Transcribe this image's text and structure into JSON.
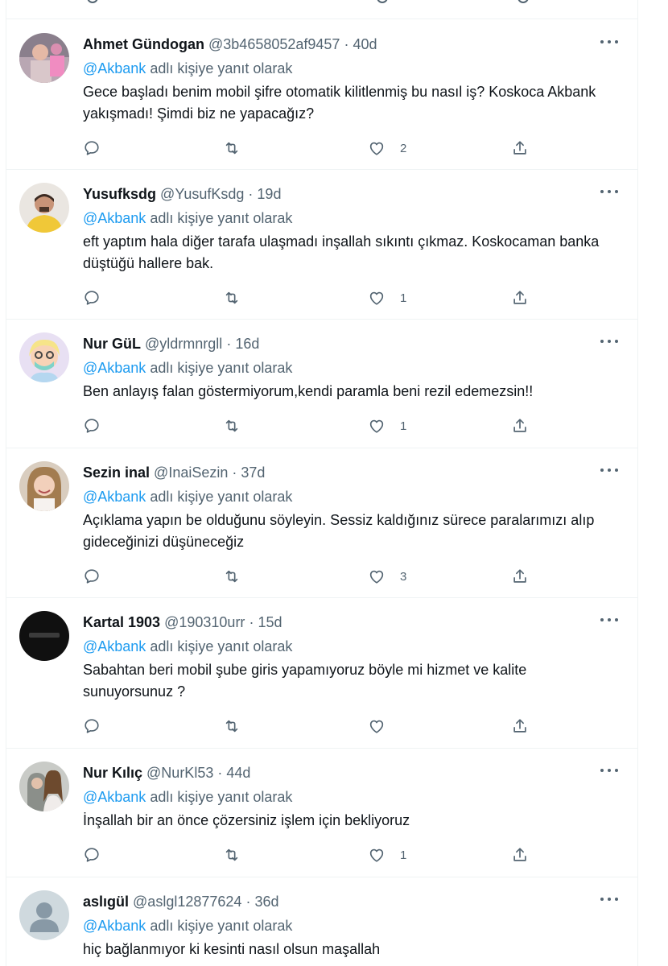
{
  "colors": {
    "accent": "#1d9bf0",
    "muted": "#536471",
    "text": "#0f1419",
    "divider": "#eff3f4"
  },
  "tweets": [
    {
      "name": "Ahmet Gündogan",
      "handle": "@3b4658052af9457",
      "dot": "·",
      "time": "40d",
      "reply_mention": "@Akbank",
      "reply_suffix": " adlı kişiye yanıt olarak",
      "text": "Gece başladı benim mobil şifre otomatik kilitlenmiş bu nasıl iş? Koskoca Akbank yakışmadı! Şimdi biz ne yapacağız?",
      "likes": "2",
      "avatar": "photo-person-icon"
    },
    {
      "name": "Yusufksdg",
      "handle": "@YusufKsdg",
      "dot": "·",
      "time": "19d",
      "reply_mention": "@Akbank",
      "reply_suffix": " adlı kişiye yanıt olarak",
      "text": "eft yaptım hala diğer tarafa ulaşmadı inşallah sıkıntı çıkmaz. Koskocaman banka düştüğü hallere bak.",
      "likes": "1",
      "avatar": "photo-person-icon"
    },
    {
      "name": "Nur GüL",
      "handle": "@yldrmnrgll",
      "dot": "·",
      "time": "16d",
      "reply_mention": "@Akbank",
      "reply_suffix": " adlı kişiye yanıt olarak",
      "text": "Ben anlayış falan göstermiyorum,kendi paramla beni rezil edemezsin!!",
      "likes": "1",
      "avatar": "cartoon-avatar-icon"
    },
    {
      "name": "Sezin inal",
      "handle": "@InaiSezin",
      "dot": "·",
      "time": "37d",
      "reply_mention": "@Akbank",
      "reply_suffix": " adlı kişiye yanıt olarak",
      "text": "Açıklama yapın be olduğunu söyleyin. Sessiz kaldığınız sürece paralarımızı alıp gideceğinizi düşüneceğiz",
      "likes": "3",
      "avatar": "photo-person-icon"
    },
    {
      "name": "Kartal 1903",
      "handle": "@190310urr",
      "dot": "·",
      "time": "15d",
      "reply_mention": "@Akbank",
      "reply_suffix": " adlı kişiye yanıt olarak",
      "text": "Sabahtan beri mobil şube giris yapamıyoruz böyle mi hizmet ve kalite sunuyorsunuz ?",
      "likes": "",
      "avatar": "dark-logo-icon"
    },
    {
      "name": "Nur Kılıç",
      "handle": "@NurKl53",
      "dot": "·",
      "time": "44d",
      "reply_mention": "@Akbank",
      "reply_suffix": " adlı kişiye yanıt olarak",
      "text": "İnşallah bir an önce çözersiniz işlem için bekliyoruz",
      "likes": "1",
      "avatar": "photo-people-icon"
    },
    {
      "name": "aslıgül",
      "handle": "@aslgl12877624",
      "dot": "·",
      "time": "36d",
      "reply_mention": "@Akbank",
      "reply_suffix": " adlı kişiye yanıt olarak",
      "text": "hiç bağlanmıyor ki kesinti nasıl olsun maşallah",
      "likes": "",
      "avatar": "default-profile-icon"
    }
  ]
}
